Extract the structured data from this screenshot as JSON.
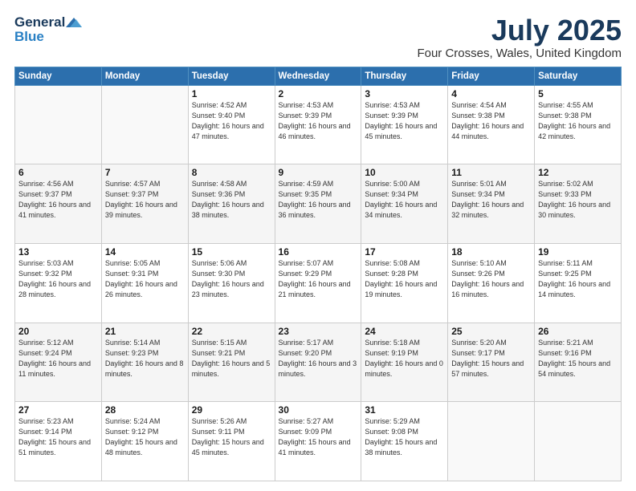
{
  "logo": {
    "general": "General",
    "blue": "Blue"
  },
  "title": {
    "month_year": "July 2025",
    "location": "Four Crosses, Wales, United Kingdom"
  },
  "weekdays": [
    "Sunday",
    "Monday",
    "Tuesday",
    "Wednesday",
    "Thursday",
    "Friday",
    "Saturday"
  ],
  "weeks": [
    [
      {
        "day": "",
        "sunrise": "",
        "sunset": "",
        "daylight": ""
      },
      {
        "day": "",
        "sunrise": "",
        "sunset": "",
        "daylight": ""
      },
      {
        "day": "1",
        "sunrise": "Sunrise: 4:52 AM",
        "sunset": "Sunset: 9:40 PM",
        "daylight": "Daylight: 16 hours and 47 minutes."
      },
      {
        "day": "2",
        "sunrise": "Sunrise: 4:53 AM",
        "sunset": "Sunset: 9:39 PM",
        "daylight": "Daylight: 16 hours and 46 minutes."
      },
      {
        "day": "3",
        "sunrise": "Sunrise: 4:53 AM",
        "sunset": "Sunset: 9:39 PM",
        "daylight": "Daylight: 16 hours and 45 minutes."
      },
      {
        "day": "4",
        "sunrise": "Sunrise: 4:54 AM",
        "sunset": "Sunset: 9:38 PM",
        "daylight": "Daylight: 16 hours and 44 minutes."
      },
      {
        "day": "5",
        "sunrise": "Sunrise: 4:55 AM",
        "sunset": "Sunset: 9:38 PM",
        "daylight": "Daylight: 16 hours and 42 minutes."
      }
    ],
    [
      {
        "day": "6",
        "sunrise": "Sunrise: 4:56 AM",
        "sunset": "Sunset: 9:37 PM",
        "daylight": "Daylight: 16 hours and 41 minutes."
      },
      {
        "day": "7",
        "sunrise": "Sunrise: 4:57 AM",
        "sunset": "Sunset: 9:37 PM",
        "daylight": "Daylight: 16 hours and 39 minutes."
      },
      {
        "day": "8",
        "sunrise": "Sunrise: 4:58 AM",
        "sunset": "Sunset: 9:36 PM",
        "daylight": "Daylight: 16 hours and 38 minutes."
      },
      {
        "day": "9",
        "sunrise": "Sunrise: 4:59 AM",
        "sunset": "Sunset: 9:35 PM",
        "daylight": "Daylight: 16 hours and 36 minutes."
      },
      {
        "day": "10",
        "sunrise": "Sunrise: 5:00 AM",
        "sunset": "Sunset: 9:34 PM",
        "daylight": "Daylight: 16 hours and 34 minutes."
      },
      {
        "day": "11",
        "sunrise": "Sunrise: 5:01 AM",
        "sunset": "Sunset: 9:34 PM",
        "daylight": "Daylight: 16 hours and 32 minutes."
      },
      {
        "day": "12",
        "sunrise": "Sunrise: 5:02 AM",
        "sunset": "Sunset: 9:33 PM",
        "daylight": "Daylight: 16 hours and 30 minutes."
      }
    ],
    [
      {
        "day": "13",
        "sunrise": "Sunrise: 5:03 AM",
        "sunset": "Sunset: 9:32 PM",
        "daylight": "Daylight: 16 hours and 28 minutes."
      },
      {
        "day": "14",
        "sunrise": "Sunrise: 5:05 AM",
        "sunset": "Sunset: 9:31 PM",
        "daylight": "Daylight: 16 hours and 26 minutes."
      },
      {
        "day": "15",
        "sunrise": "Sunrise: 5:06 AM",
        "sunset": "Sunset: 9:30 PM",
        "daylight": "Daylight: 16 hours and 23 minutes."
      },
      {
        "day": "16",
        "sunrise": "Sunrise: 5:07 AM",
        "sunset": "Sunset: 9:29 PM",
        "daylight": "Daylight: 16 hours and 21 minutes."
      },
      {
        "day": "17",
        "sunrise": "Sunrise: 5:08 AM",
        "sunset": "Sunset: 9:28 PM",
        "daylight": "Daylight: 16 hours and 19 minutes."
      },
      {
        "day": "18",
        "sunrise": "Sunrise: 5:10 AM",
        "sunset": "Sunset: 9:26 PM",
        "daylight": "Daylight: 16 hours and 16 minutes."
      },
      {
        "day": "19",
        "sunrise": "Sunrise: 5:11 AM",
        "sunset": "Sunset: 9:25 PM",
        "daylight": "Daylight: 16 hours and 14 minutes."
      }
    ],
    [
      {
        "day": "20",
        "sunrise": "Sunrise: 5:12 AM",
        "sunset": "Sunset: 9:24 PM",
        "daylight": "Daylight: 16 hours and 11 minutes."
      },
      {
        "day": "21",
        "sunrise": "Sunrise: 5:14 AM",
        "sunset": "Sunset: 9:23 PM",
        "daylight": "Daylight: 16 hours and 8 minutes."
      },
      {
        "day": "22",
        "sunrise": "Sunrise: 5:15 AM",
        "sunset": "Sunset: 9:21 PM",
        "daylight": "Daylight: 16 hours and 5 minutes."
      },
      {
        "day": "23",
        "sunrise": "Sunrise: 5:17 AM",
        "sunset": "Sunset: 9:20 PM",
        "daylight": "Daylight: 16 hours and 3 minutes."
      },
      {
        "day": "24",
        "sunrise": "Sunrise: 5:18 AM",
        "sunset": "Sunset: 9:19 PM",
        "daylight": "Daylight: 16 hours and 0 minutes."
      },
      {
        "day": "25",
        "sunrise": "Sunrise: 5:20 AM",
        "sunset": "Sunset: 9:17 PM",
        "daylight": "Daylight: 15 hours and 57 minutes."
      },
      {
        "day": "26",
        "sunrise": "Sunrise: 5:21 AM",
        "sunset": "Sunset: 9:16 PM",
        "daylight": "Daylight: 15 hours and 54 minutes."
      }
    ],
    [
      {
        "day": "27",
        "sunrise": "Sunrise: 5:23 AM",
        "sunset": "Sunset: 9:14 PM",
        "daylight": "Daylight: 15 hours and 51 minutes."
      },
      {
        "day": "28",
        "sunrise": "Sunrise: 5:24 AM",
        "sunset": "Sunset: 9:12 PM",
        "daylight": "Daylight: 15 hours and 48 minutes."
      },
      {
        "day": "29",
        "sunrise": "Sunrise: 5:26 AM",
        "sunset": "Sunset: 9:11 PM",
        "daylight": "Daylight: 15 hours and 45 minutes."
      },
      {
        "day": "30",
        "sunrise": "Sunrise: 5:27 AM",
        "sunset": "Sunset: 9:09 PM",
        "daylight": "Daylight: 15 hours and 41 minutes."
      },
      {
        "day": "31",
        "sunrise": "Sunrise: 5:29 AM",
        "sunset": "Sunset: 9:08 PM",
        "daylight": "Daylight: 15 hours and 38 minutes."
      },
      {
        "day": "",
        "sunrise": "",
        "sunset": "",
        "daylight": ""
      },
      {
        "day": "",
        "sunrise": "",
        "sunset": "",
        "daylight": ""
      }
    ]
  ]
}
